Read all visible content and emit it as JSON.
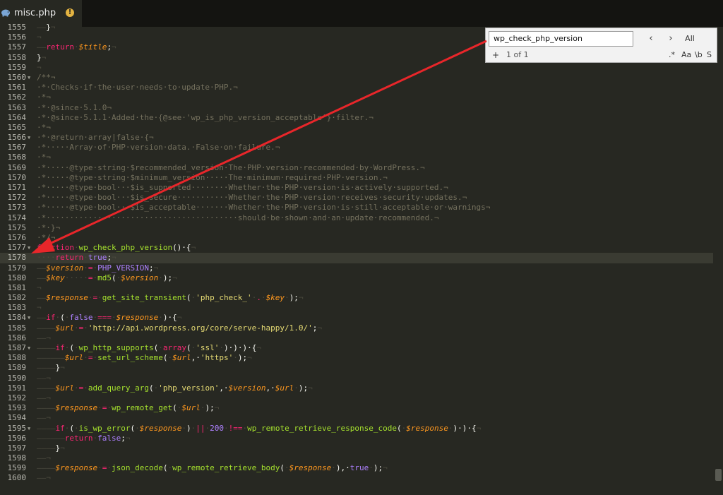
{
  "tab": {
    "title": "misc.php",
    "icon": "php-elephant-icon",
    "status_icon": "unsaved-warning-icon",
    "status_glyph": "!"
  },
  "find": {
    "query": "wp_check_php_version",
    "prev_glyph": "‹",
    "next_glyph": "›",
    "all_label": "All",
    "add_glyph": "+",
    "result": "1 of 1",
    "regex_label": ".*",
    "case_label": "Aa",
    "word_label": "\\b",
    "selection_label": "S"
  },
  "colors": {
    "background": "#272822",
    "keyword": "#f92672",
    "variable": "#fd971f",
    "function": "#a6e22e",
    "string": "#e6db74",
    "constant": "#ae81ff",
    "comment": "#75715e",
    "arrow": "#e8262a"
  },
  "editor": {
    "lines": [
      {
        "n": "1555",
        "tokens": [
          [
            "ws",
            "——"
          ],
          [
            "plain",
            "}"
          ],
          [
            "ws",
            "¬"
          ]
        ]
      },
      {
        "n": "1556",
        "tokens": [
          [
            "ws",
            "¬"
          ]
        ]
      },
      {
        "n": "1557",
        "tokens": [
          [
            "ws",
            "——"
          ],
          [
            "kw",
            "return"
          ],
          [
            "ws",
            "·"
          ],
          [
            "var",
            "$title"
          ],
          [
            "plain",
            ";"
          ],
          [
            "ws",
            "¬"
          ]
        ]
      },
      {
        "n": "1558",
        "tokens": [
          [
            "plain",
            "}"
          ],
          [
            "ws",
            "¬"
          ]
        ]
      },
      {
        "n": "1559",
        "tokens": [
          [
            "ws",
            "¬"
          ]
        ]
      },
      {
        "n": "1560",
        "fold": true,
        "tokens": [
          [
            "comment",
            "/**¬"
          ]
        ]
      },
      {
        "n": "1561",
        "tokens": [
          [
            "comment",
            "·*·Checks·if·the·user·needs·to·update·PHP.¬"
          ]
        ]
      },
      {
        "n": "1562",
        "tokens": [
          [
            "comment",
            "·*¬"
          ]
        ]
      },
      {
        "n": "1563",
        "tokens": [
          [
            "comment",
            "·*·@since·5.1.0¬"
          ]
        ]
      },
      {
        "n": "1564",
        "tokens": [
          [
            "comment",
            "·*·@since·5.1.1·Added·the·{@see·'wp_is_php_version_acceptable'}·filter.¬"
          ]
        ]
      },
      {
        "n": "1565",
        "tokens": [
          [
            "comment",
            "·*¬"
          ]
        ]
      },
      {
        "n": "1566",
        "fold": true,
        "tokens": [
          [
            "comment",
            "·*·@return·array|false·{¬"
          ]
        ]
      },
      {
        "n": "1567",
        "tokens": [
          [
            "comment",
            "·*·····Array·of·PHP·version·data.·False·on·failure.¬"
          ]
        ]
      },
      {
        "n": "1568",
        "tokens": [
          [
            "comment",
            "·*¬"
          ]
        ]
      },
      {
        "n": "1569",
        "tokens": [
          [
            "comment",
            "·*·····@type·string·$recommended_version·The·PHP·version·recommended·by·WordPress.¬"
          ]
        ]
      },
      {
        "n": "1570",
        "tokens": [
          [
            "comment",
            "·*·····@type·string·$minimum_version·····The·minimum·required·PHP·version.¬"
          ]
        ]
      },
      {
        "n": "1571",
        "tokens": [
          [
            "comment",
            "·*·····@type·bool···$is_supported········Whether·the·PHP·version·is·actively·supported.¬"
          ]
        ]
      },
      {
        "n": "1572",
        "tokens": [
          [
            "comment",
            "·*·····@type·bool···$is_secure···········Whether·the·PHP·version·receives·security·updates.¬"
          ]
        ]
      },
      {
        "n": "1573",
        "tokens": [
          [
            "comment",
            "·*·····@type·bool···$is_acceptable·······Whether·the·PHP·version·is·still·acceptable·or·warnings¬"
          ]
        ]
      },
      {
        "n": "1574",
        "tokens": [
          [
            "comment",
            "·*·········································should·be·shown·and·an·update·recommended.¬"
          ]
        ]
      },
      {
        "n": "1575",
        "tokens": [
          [
            "comment",
            "·*·}¬"
          ]
        ]
      },
      {
        "n": "1576",
        "tokens": [
          [
            "comment",
            "·*/¬"
          ]
        ]
      },
      {
        "n": "1577",
        "fold": true,
        "tokens": [
          [
            "kw",
            "function"
          ],
          [
            "ws",
            "·"
          ],
          [
            "fn",
            "wp_check_php_version"
          ],
          [
            "plain",
            "()·{"
          ],
          [
            "ws",
            "¬"
          ]
        ]
      },
      {
        "n": "1578",
        "current": true,
        "tokens": [
          [
            "ws",
            "····"
          ],
          [
            "kw",
            "return"
          ],
          [
            "ws",
            "·"
          ],
          [
            "const",
            "true"
          ],
          [
            "plain",
            ";"
          ],
          [
            "ws",
            "¬"
          ]
        ]
      },
      {
        "n": "1579",
        "tokens": [
          [
            "ws",
            "——"
          ],
          [
            "var",
            "$version"
          ],
          [
            "ws",
            "·"
          ],
          [
            "op",
            "="
          ],
          [
            "ws",
            "·"
          ],
          [
            "const",
            "PHP_VERSION"
          ],
          [
            "plain",
            ";"
          ],
          [
            "ws",
            "¬"
          ]
        ]
      },
      {
        "n": "1580",
        "tokens": [
          [
            "ws",
            "——"
          ],
          [
            "var",
            "$key"
          ],
          [
            "ws",
            "·····"
          ],
          [
            "op",
            "="
          ],
          [
            "ws",
            "·"
          ],
          [
            "fn",
            "md5"
          ],
          [
            "plain",
            "("
          ],
          [
            "ws",
            "·"
          ],
          [
            "var",
            "$version"
          ],
          [
            "ws",
            "·"
          ],
          [
            "plain",
            ");"
          ],
          [
            "ws",
            "¬"
          ]
        ]
      },
      {
        "n": "1581",
        "tokens": [
          [
            "ws",
            "¬"
          ]
        ]
      },
      {
        "n": "1582",
        "tokens": [
          [
            "ws",
            "——"
          ],
          [
            "var",
            "$response"
          ],
          [
            "ws",
            "·"
          ],
          [
            "op",
            "="
          ],
          [
            "ws",
            "·"
          ],
          [
            "fn",
            "get_site_transient"
          ],
          [
            "plain",
            "("
          ],
          [
            "ws",
            "·"
          ],
          [
            "str",
            "'php_check_'"
          ],
          [
            "ws",
            "·"
          ],
          [
            "op",
            "."
          ],
          [
            "ws",
            "·"
          ],
          [
            "var",
            "$key"
          ],
          [
            "ws",
            "·"
          ],
          [
            "plain",
            ");"
          ],
          [
            "ws",
            "¬"
          ]
        ]
      },
      {
        "n": "1583",
        "tokens": [
          [
            "ws",
            "¬"
          ]
        ]
      },
      {
        "n": "1584",
        "fold": true,
        "tokens": [
          [
            "ws",
            "——"
          ],
          [
            "kw",
            "if"
          ],
          [
            "ws",
            "·"
          ],
          [
            "plain",
            "("
          ],
          [
            "ws",
            "·"
          ],
          [
            "const",
            "false"
          ],
          [
            "ws",
            "·"
          ],
          [
            "op",
            "==="
          ],
          [
            "ws",
            "·"
          ],
          [
            "var",
            "$response"
          ],
          [
            "ws",
            "·"
          ],
          [
            "plain",
            ")·{"
          ],
          [
            "ws",
            "¬"
          ]
        ]
      },
      {
        "n": "1585",
        "tokens": [
          [
            "ws",
            "————"
          ],
          [
            "var",
            "$url"
          ],
          [
            "ws",
            "·"
          ],
          [
            "op",
            "="
          ],
          [
            "ws",
            "·"
          ],
          [
            "str",
            "'http://api.wordpress.org/core/serve-happy/1.0/'"
          ],
          [
            "plain",
            ";"
          ],
          [
            "ws",
            "¬"
          ]
        ]
      },
      {
        "n": "1586",
        "tokens": [
          [
            "ws",
            "——"
          ],
          [
            "ws",
            "¬"
          ]
        ]
      },
      {
        "n": "1587",
        "fold": true,
        "tokens": [
          [
            "ws",
            "————"
          ],
          [
            "kw",
            "if"
          ],
          [
            "ws",
            "·"
          ],
          [
            "plain",
            "("
          ],
          [
            "ws",
            "·"
          ],
          [
            "fn",
            "wp_http_supports"
          ],
          [
            "plain",
            "("
          ],
          [
            "ws",
            "·"
          ],
          [
            "kw",
            "array"
          ],
          [
            "plain",
            "("
          ],
          [
            "ws",
            "·"
          ],
          [
            "str",
            "'ssl'"
          ],
          [
            "ws",
            "·"
          ],
          [
            "plain",
            ")·)·)·{"
          ],
          [
            "ws",
            "¬"
          ]
        ]
      },
      {
        "n": "1588",
        "tokens": [
          [
            "ws",
            "——————"
          ],
          [
            "var",
            "$url"
          ],
          [
            "ws",
            "·"
          ],
          [
            "op",
            "="
          ],
          [
            "ws",
            "·"
          ],
          [
            "fn",
            "set_url_scheme"
          ],
          [
            "plain",
            "("
          ],
          [
            "ws",
            "·"
          ],
          [
            "var",
            "$url"
          ],
          [
            "plain",
            ",·"
          ],
          [
            "str",
            "'https'"
          ],
          [
            "ws",
            "·"
          ],
          [
            "plain",
            ");"
          ],
          [
            "ws",
            "¬"
          ]
        ]
      },
      {
        "n": "1589",
        "tokens": [
          [
            "ws",
            "————"
          ],
          [
            "plain",
            "}"
          ],
          [
            "ws",
            "¬"
          ]
        ]
      },
      {
        "n": "1590",
        "tokens": [
          [
            "ws",
            "——"
          ],
          [
            "ws",
            "¬"
          ]
        ]
      },
      {
        "n": "1591",
        "tokens": [
          [
            "ws",
            "————"
          ],
          [
            "var",
            "$url"
          ],
          [
            "ws",
            "·"
          ],
          [
            "op",
            "="
          ],
          [
            "ws",
            "·"
          ],
          [
            "fn",
            "add_query_arg"
          ],
          [
            "plain",
            "("
          ],
          [
            "ws",
            "·"
          ],
          [
            "str",
            "'php_version'"
          ],
          [
            "plain",
            ",·"
          ],
          [
            "var",
            "$version"
          ],
          [
            "plain",
            ",·"
          ],
          [
            "var",
            "$url"
          ],
          [
            "ws",
            "·"
          ],
          [
            "plain",
            ");"
          ],
          [
            "ws",
            "¬"
          ]
        ]
      },
      {
        "n": "1592",
        "tokens": [
          [
            "ws",
            "——"
          ],
          [
            "ws",
            "¬"
          ]
        ]
      },
      {
        "n": "1593",
        "tokens": [
          [
            "ws",
            "————"
          ],
          [
            "var",
            "$response"
          ],
          [
            "ws",
            "·"
          ],
          [
            "op",
            "="
          ],
          [
            "ws",
            "·"
          ],
          [
            "fn",
            "wp_remote_get"
          ],
          [
            "plain",
            "("
          ],
          [
            "ws",
            "·"
          ],
          [
            "var",
            "$url"
          ],
          [
            "ws",
            "·"
          ],
          [
            "plain",
            ");"
          ],
          [
            "ws",
            "¬"
          ]
        ]
      },
      {
        "n": "1594",
        "tokens": [
          [
            "ws",
            "——"
          ],
          [
            "ws",
            "¬"
          ]
        ]
      },
      {
        "n": "1595",
        "fold": true,
        "tokens": [
          [
            "ws",
            "————"
          ],
          [
            "kw",
            "if"
          ],
          [
            "ws",
            "·"
          ],
          [
            "plain",
            "("
          ],
          [
            "ws",
            "·"
          ],
          [
            "fn",
            "is_wp_error"
          ],
          [
            "plain",
            "("
          ],
          [
            "ws",
            "·"
          ],
          [
            "var",
            "$response"
          ],
          [
            "ws",
            "·"
          ],
          [
            "plain",
            ")"
          ],
          [
            "ws",
            "·"
          ],
          [
            "op",
            "||"
          ],
          [
            "ws",
            "·"
          ],
          [
            "const",
            "200"
          ],
          [
            "ws",
            "·"
          ],
          [
            "op",
            "!=="
          ],
          [
            "ws",
            "·"
          ],
          [
            "fn",
            "wp_remote_retrieve_response_code"
          ],
          [
            "plain",
            "("
          ],
          [
            "ws",
            "·"
          ],
          [
            "var",
            "$response"
          ],
          [
            "ws",
            "·"
          ],
          [
            "plain",
            ")·)·{"
          ],
          [
            "ws",
            "¬"
          ]
        ]
      },
      {
        "n": "1596",
        "tokens": [
          [
            "ws",
            "——————"
          ],
          [
            "kw",
            "return"
          ],
          [
            "ws",
            "·"
          ],
          [
            "const",
            "false"
          ],
          [
            "plain",
            ";"
          ],
          [
            "ws",
            "¬"
          ]
        ]
      },
      {
        "n": "1597",
        "tokens": [
          [
            "ws",
            "————"
          ],
          [
            "plain",
            "}"
          ],
          [
            "ws",
            "¬"
          ]
        ]
      },
      {
        "n": "1598",
        "tokens": [
          [
            "ws",
            "——"
          ],
          [
            "ws",
            "¬"
          ]
        ]
      },
      {
        "n": "1599",
        "tokens": [
          [
            "ws",
            "————"
          ],
          [
            "var",
            "$response"
          ],
          [
            "ws",
            "·"
          ],
          [
            "op",
            "="
          ],
          [
            "ws",
            "·"
          ],
          [
            "fn",
            "json_decode"
          ],
          [
            "plain",
            "("
          ],
          [
            "ws",
            "·"
          ],
          [
            "fn",
            "wp_remote_retrieve_body"
          ],
          [
            "plain",
            "("
          ],
          [
            "ws",
            "·"
          ],
          [
            "var",
            "$response"
          ],
          [
            "ws",
            "·"
          ],
          [
            "plain",
            "),·"
          ],
          [
            "const",
            "true"
          ],
          [
            "ws",
            "·"
          ],
          [
            "plain",
            ");"
          ],
          [
            "ws",
            "¬"
          ]
        ]
      },
      {
        "n": "1600",
        "tokens": [
          [
            "ws",
            "——"
          ],
          [
            "ws",
            "¬"
          ]
        ]
      }
    ]
  }
}
